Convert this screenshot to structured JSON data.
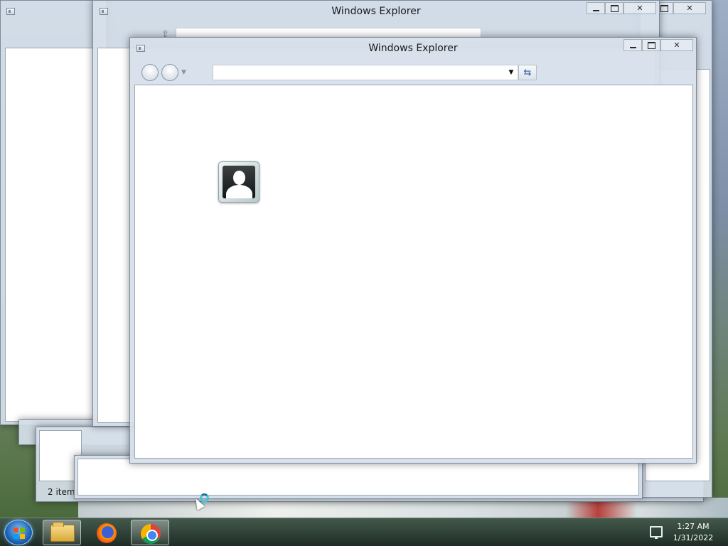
{
  "front_window": {
    "title": "Windows Explorer",
    "address_value": "",
    "refresh_glyph": "⇆"
  },
  "back_window": {
    "title": "Windows Explorer"
  },
  "status_window": {
    "status_text": "2 items"
  },
  "taskbar": {
    "clock_time": "1:27 AM",
    "clock_date": "1/31/2022",
    "apps": [
      "windows-explorer",
      "firefox",
      "chrome"
    ]
  },
  "icons": {
    "start": "windows-logo-icon",
    "avatar": "user-account-icon",
    "tray": "network-icon"
  },
  "colors": {
    "window_frame": "#d6e0ea",
    "taskbar": "#1f3430",
    "content_bg": "#ffffff"
  }
}
